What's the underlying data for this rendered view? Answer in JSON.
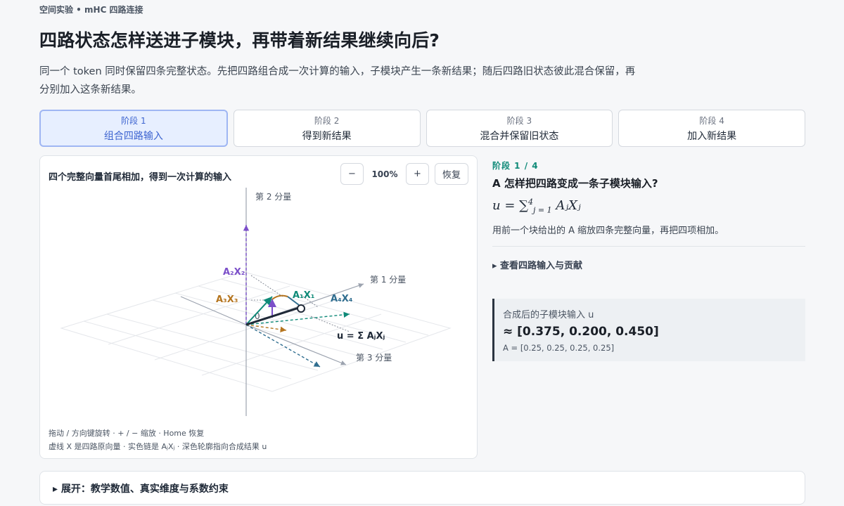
{
  "header": {
    "eyebrow": "空间实验 • mHC 四路连接",
    "title": "四路状态怎样送进子模块，再带着新结果继续向后?",
    "subtitle": "同一个 token 同时保留四条完整状态。先把四路组合成一次计算的输入，子模块产生一条新结果；随后四路旧状态彼此混合保留，再分别加入这条新结果。"
  },
  "stages": [
    {
      "num": "阶段 1",
      "label": "组合四路输入",
      "active": true
    },
    {
      "num": "阶段 2",
      "label": "得到新结果",
      "active": false
    },
    {
      "num": "阶段 3",
      "label": "混合并保留旧状态",
      "active": false
    },
    {
      "num": "阶段 4",
      "label": "加入新结果",
      "active": false
    }
  ],
  "viz": {
    "title": "四个完整向量首尾相加，得到一次计算的输入",
    "zoom_out": "−",
    "zoom_value": "100%",
    "zoom_in": "+",
    "reset": "恢复",
    "axis_labels": {
      "axis2": "第 2 分量",
      "axis1": "第 1 分量",
      "axis3": "第 3 分量",
      "origin": "0"
    },
    "vector_labels": {
      "a2x2": "A₂X₂",
      "a3x3": "A₃X₃",
      "a1x1": "A₁X₁",
      "a4x4": "A₄X₄",
      "u": "u = Σ AⱼXⱼ"
    },
    "hint1": "拖动 / 方向键旋转 · + / − 缩放 · Home 恢复",
    "hint2": "虚线 X 是四路原向量 · 实色链是 AⱼXⱼ · 深色轮廓指向合成结果 u",
    "colors": {
      "a1": "#0f8a78",
      "a2": "#7b4fc9",
      "a3": "#b5751f",
      "a4": "#2f6d8f",
      "u": "#1f2937"
    }
  },
  "info": {
    "step": "阶段 1 / 4",
    "question": "A 怎样把四路变成一条子模块输入?",
    "formula_lhs": "u =",
    "formula_sum": "∑",
    "formula_sub": "j = 1",
    "formula_sup": "4",
    "formula_term": "AⱼXⱼ",
    "description": "用前一个块给出的 A 缩放四条完整向量，再把四项相加。",
    "details_label": "▸ 查看四路输入与贡献"
  },
  "result": {
    "label": "合成后的子模块输入 u",
    "value": "≈ [0.375, 0.200, 0.450]",
    "coeffs": "A = [0.25, 0.25, 0.25, 0.25]"
  },
  "expand_label": "▸ 展开：教学数值、真实维度与系数约束"
}
